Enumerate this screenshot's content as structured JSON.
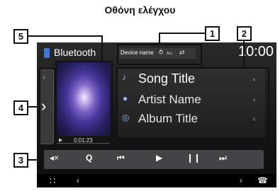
{
  "heading": "Οθόνη ελέγχου",
  "header": {
    "source_title": "Bluetooth",
    "device_name": "Device name",
    "repeat_mode": "ALL",
    "clock": "10:00"
  },
  "track": {
    "song_title": "Song Title",
    "artist_name": "Artist Name",
    "album_title": "Album Title",
    "play_time": "0:01:23"
  },
  "callouts": [
    "1",
    "2",
    "3",
    "4",
    "5"
  ],
  "controls": [
    "mute",
    "search",
    "previous",
    "play",
    "pause",
    "next"
  ],
  "icons": {
    "source": "bluetooth-phone-icon",
    "repeat": "repeat-icon",
    "shuffle": "shuffle-icon",
    "song": "music-note-icon",
    "artist": "person-icon",
    "album": "disc-icon",
    "menu": "grid-menu-icon",
    "phone": "phone-icon"
  },
  "colors": {
    "screen_bg": "#1a1a1a",
    "control_bar": "#444446",
    "text": "#ffffff",
    "accent": "#8fb4ff",
    "callout": "#111111"
  }
}
